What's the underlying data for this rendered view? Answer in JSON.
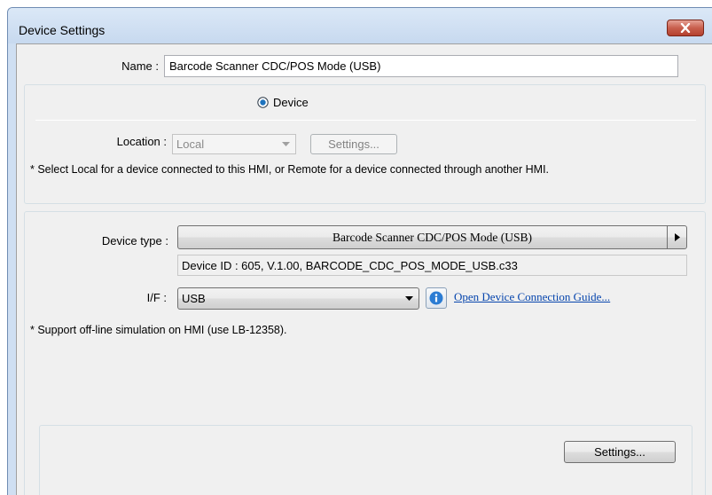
{
  "window": {
    "title": "Device Settings"
  },
  "name_field": {
    "label": "Name :",
    "value": "Barcode Scanner CDC/POS Mode (USB)"
  },
  "mode": {
    "radio_label": "Device",
    "selected": true
  },
  "location": {
    "label": "Location :",
    "value": "Local",
    "settings_label": "Settings...",
    "note": "* Select Local for a device connected to this HMI, or Remote for a device connected through another HMI."
  },
  "device": {
    "type_label": "Device type :",
    "type_value": "Barcode Scanner CDC/POS Mode (USB)",
    "id_text": "Device ID : 605, V.1.00, BARCODE_CDC_POS_MODE_USB.c33",
    "if_label": "I/F :",
    "if_value": "USB",
    "guide_link": "Open Device Connection Guide...",
    "support_note": "* Support off-line simulation on HMI (use LB-12358).",
    "settings_label": "Settings..."
  },
  "colors": {
    "accent": "#1e73be",
    "close": "#c85f4d",
    "link": "#0645ad"
  }
}
